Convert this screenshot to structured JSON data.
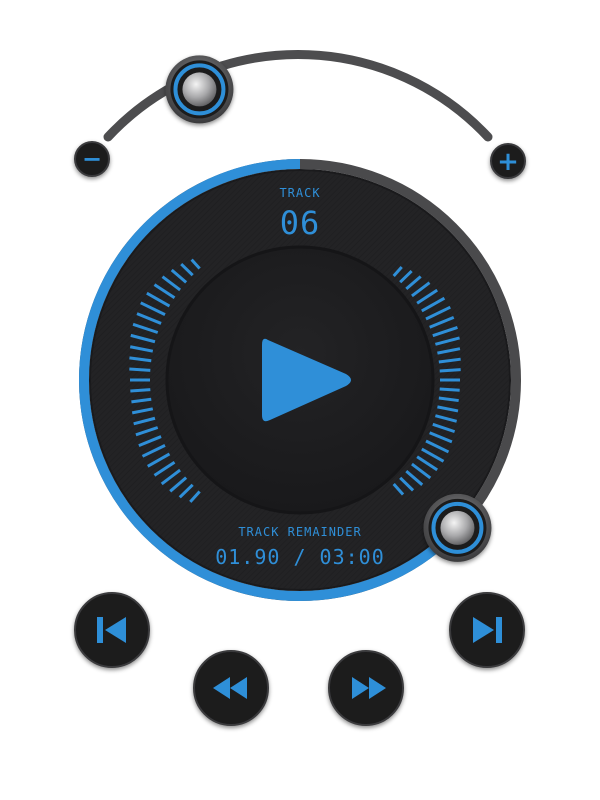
{
  "player": {
    "track_label": "TRACK",
    "track_number": "06",
    "remainder_label": "TRACK REMAINDER",
    "time_display": "01.90 / 03:00",
    "progress_fraction": 0.63,
    "volume_fraction": 0.25
  },
  "volume": {
    "minus_label": "−",
    "plus_label": "+"
  },
  "controls": {
    "play": "play-icon",
    "skip_back": "skip-back-icon",
    "rewind": "rewind-icon",
    "fast_forward": "fast-forward-icon",
    "skip_forward": "skip-forward-icon"
  },
  "colors": {
    "accent": "#2f8fd8",
    "dark": "#1c1c1e",
    "ring": "#4a4a4c",
    "bg": "#ffffff"
  }
}
